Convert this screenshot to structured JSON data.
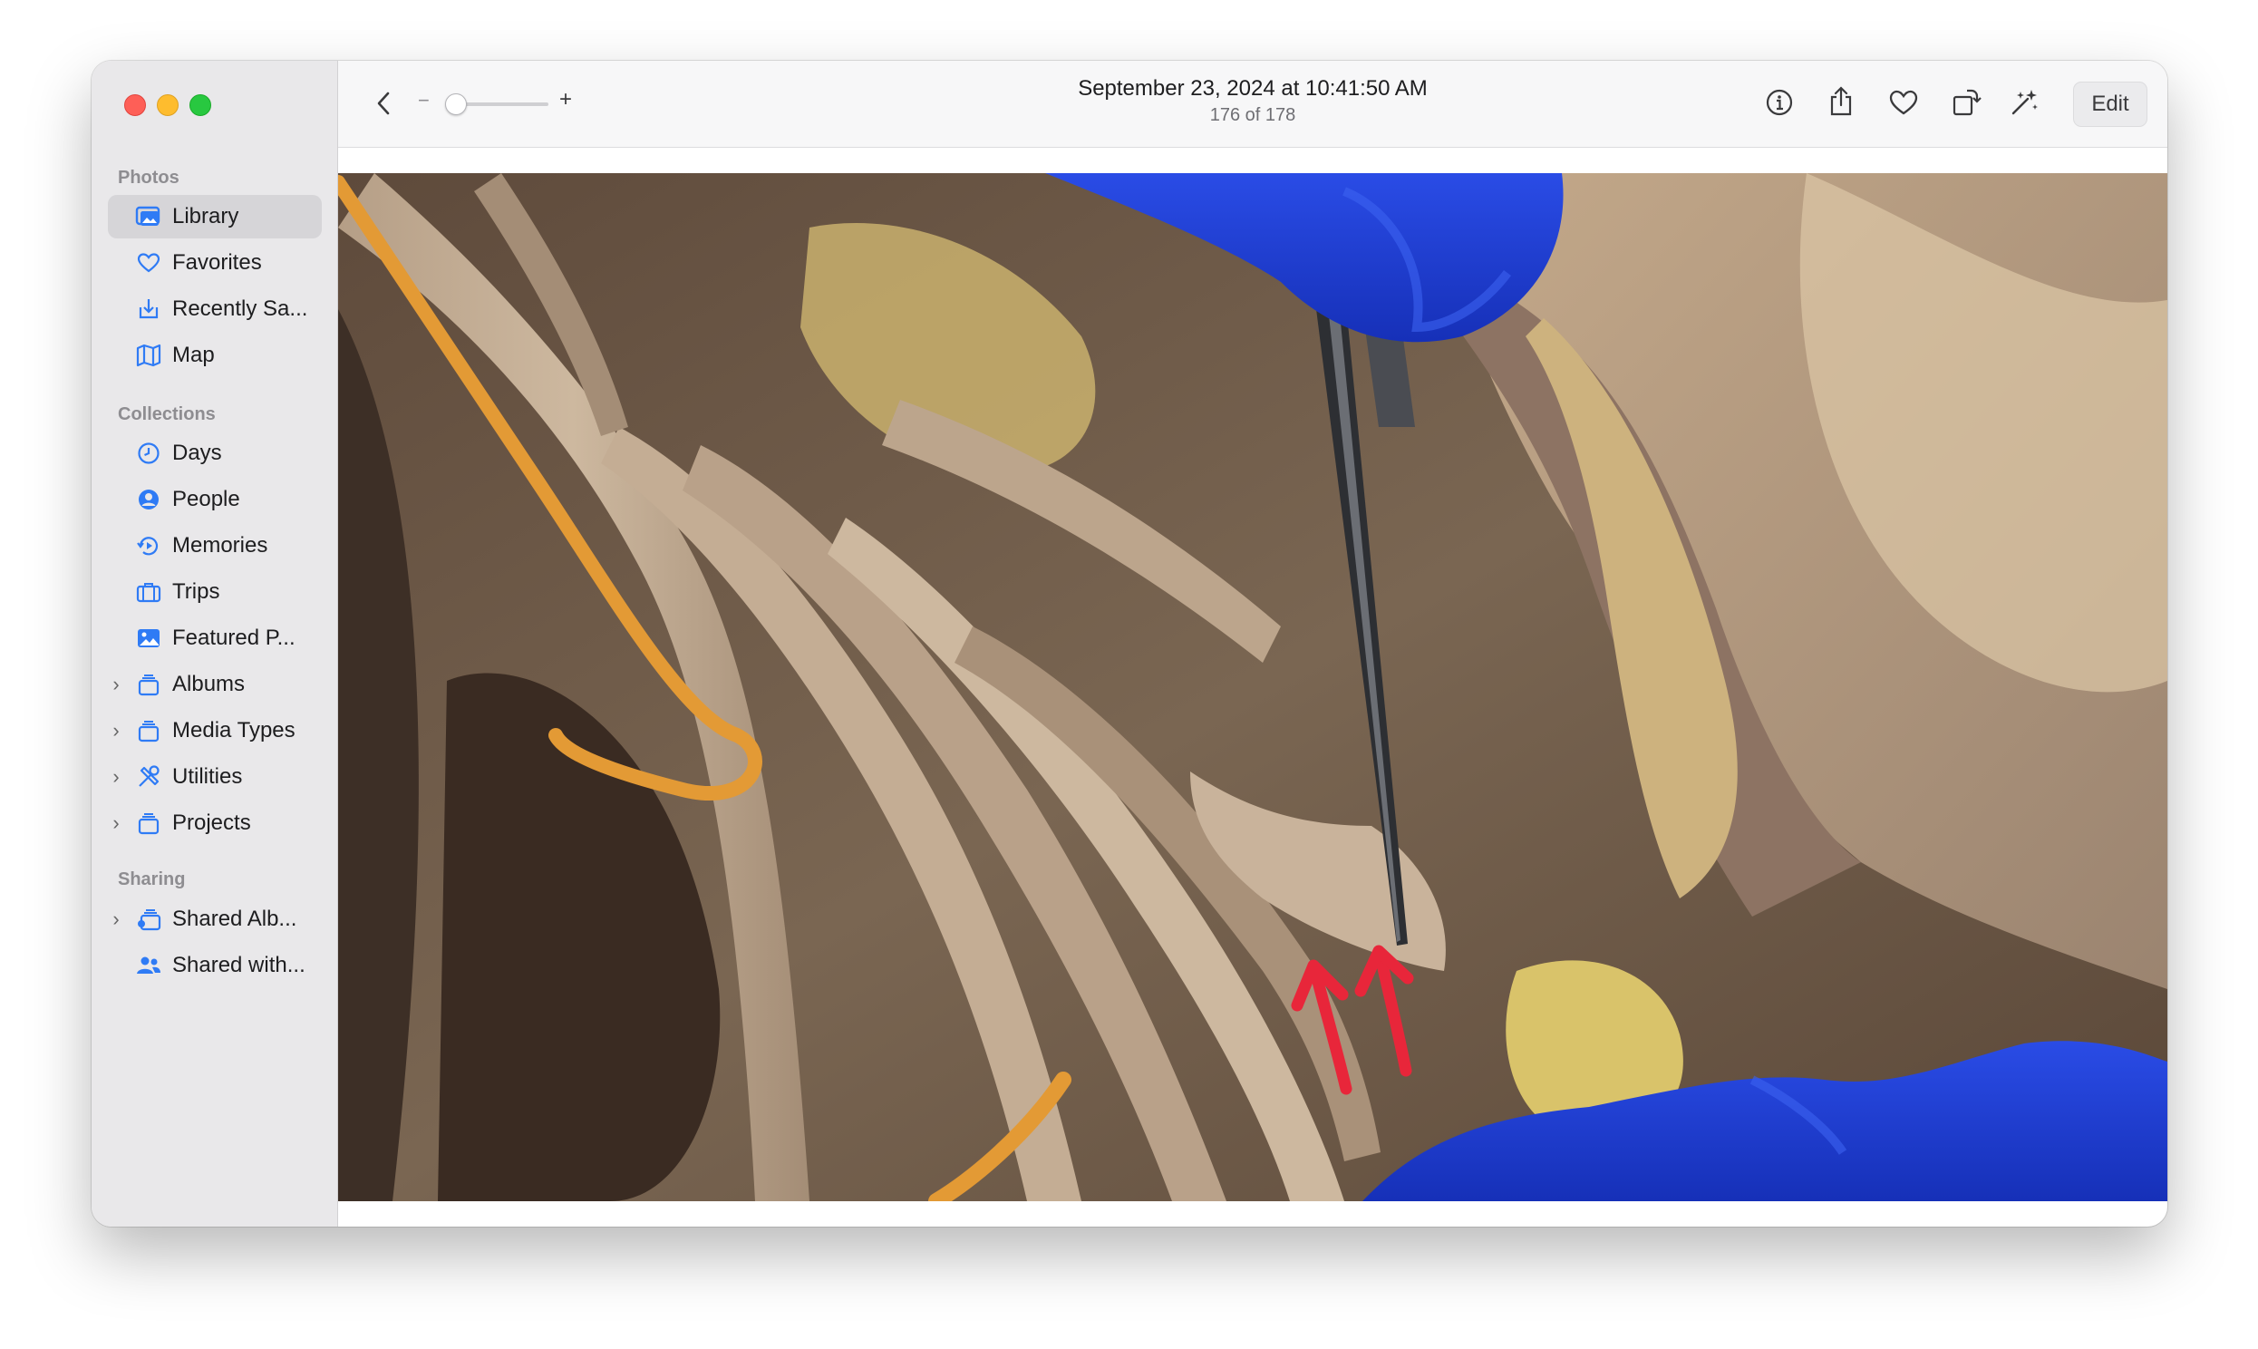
{
  "window": {
    "title": "September 23, 2024 at 10:41:50 AM",
    "subtitle": "176 of 178"
  },
  "toolbar": {
    "zoom_minus": "−",
    "zoom_plus": "+",
    "zoom_level": 0.05,
    "edit_label": "Edit",
    "icons": [
      "back-chevron-icon",
      "info-icon",
      "share-icon",
      "heart-icon",
      "rotate-icon",
      "magic-wand-icon"
    ]
  },
  "sidebar": {
    "sections": {
      "photos": "Photos",
      "collections": "Collections",
      "sharing": "Sharing"
    },
    "items": [
      {
        "label": "Library",
        "icon": "photo-library-icon",
        "selected": true
      },
      {
        "label": "Favorites",
        "icon": "heart-icon"
      },
      {
        "label": "Recently Sa...",
        "icon": "tray-download-icon"
      },
      {
        "label": "Map",
        "icon": "map-icon"
      },
      {
        "label": "Days",
        "icon": "clock-icon"
      },
      {
        "label": "People",
        "icon": "person-circle-icon"
      },
      {
        "label": "Memories",
        "icon": "memories-icon"
      },
      {
        "label": "Trips",
        "icon": "suitcase-icon"
      },
      {
        "label": "Featured P...",
        "icon": "featured-photo-icon"
      },
      {
        "label": "Albums",
        "icon": "album-stack-icon"
      },
      {
        "label": "Media Types",
        "icon": "album-stack-icon"
      },
      {
        "label": "Utilities",
        "icon": "tools-icon"
      },
      {
        "label": "Projects",
        "icon": "album-stack-icon"
      },
      {
        "label": "Shared Alb...",
        "icon": "shared-album-icon"
      },
      {
        "label": "Shared with...",
        "icon": "people-icon"
      }
    ]
  },
  "colors": {
    "accent": "#2f7bf5",
    "glove_blue": "#1f3fd6",
    "annotation_red": "#e8263a"
  }
}
